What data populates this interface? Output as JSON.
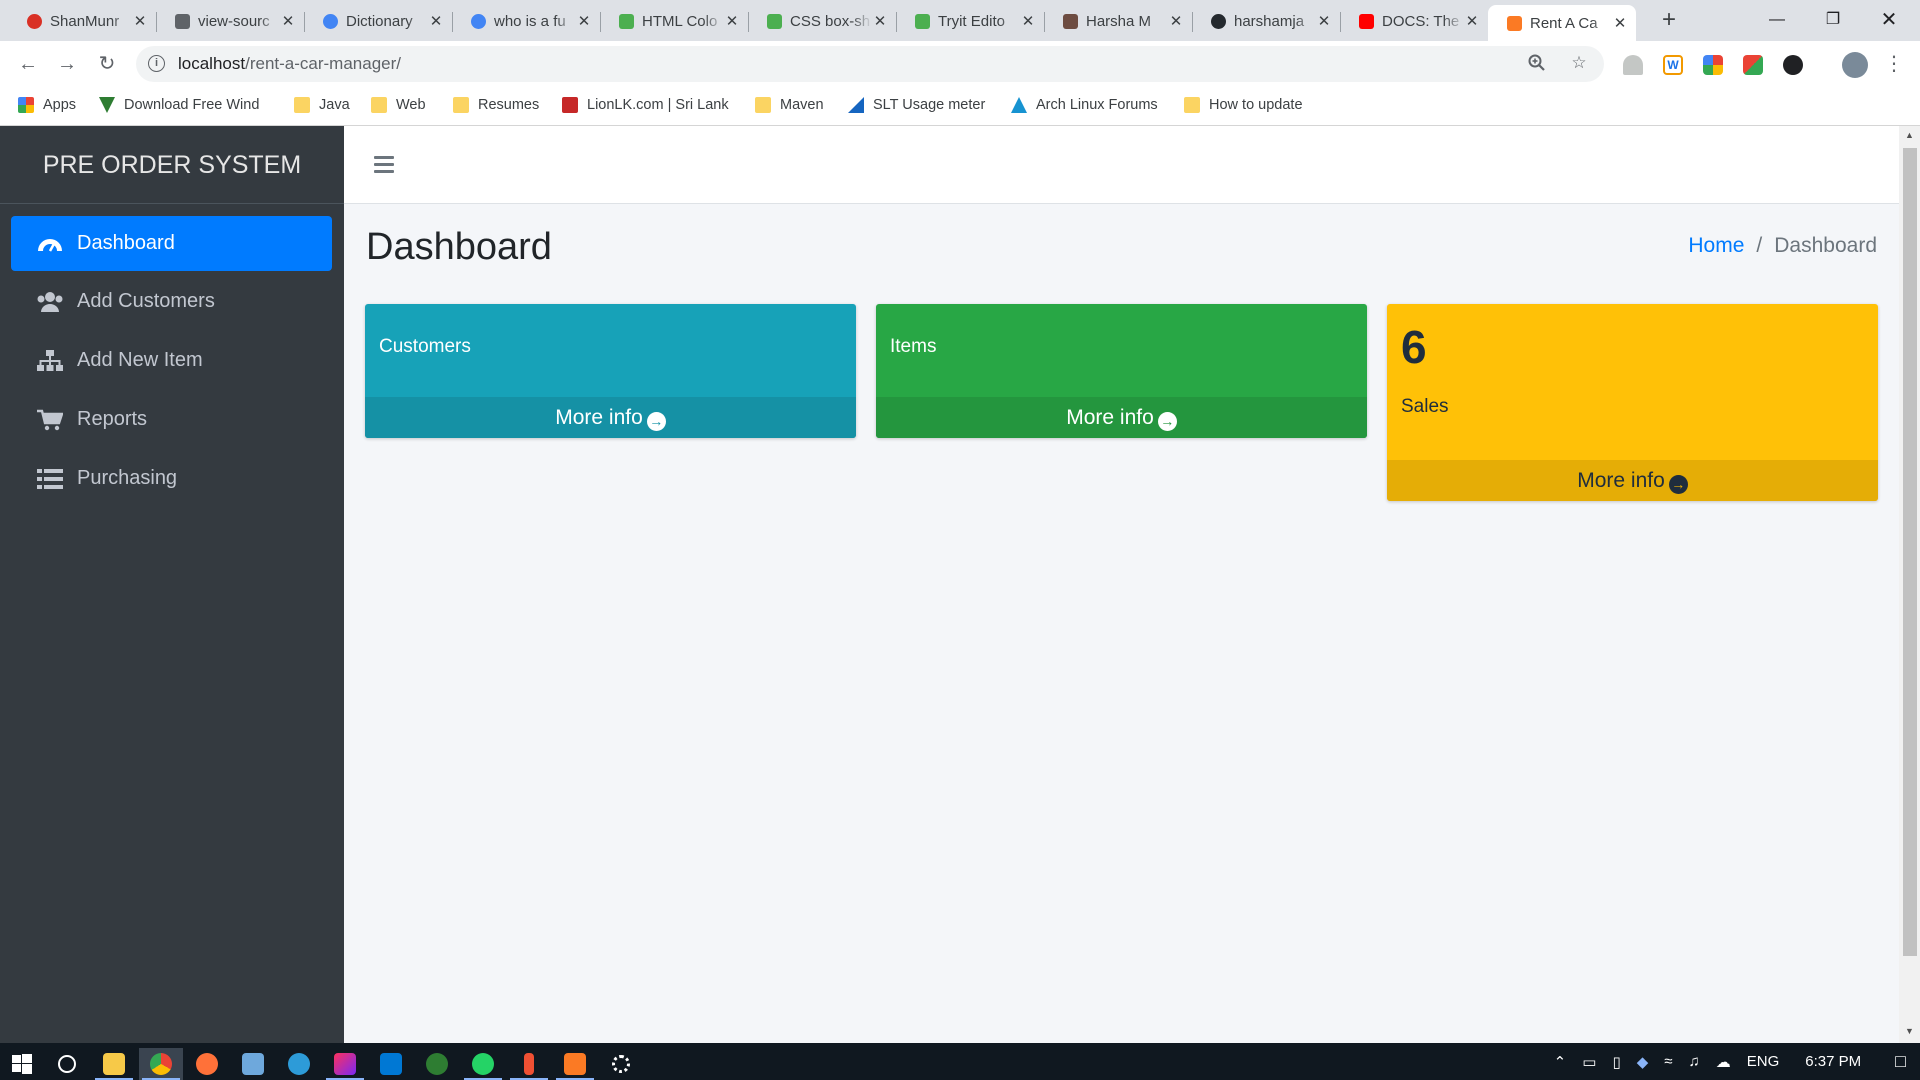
{
  "tabs": [
    {
      "title": "ShanMunr",
      "favicon": "shanmuni-icon",
      "color": "#d93025"
    },
    {
      "title": "view-sourc",
      "favicon": "document-icon",
      "color": "#5f6368"
    },
    {
      "title": "Dictionary",
      "favicon": "google-icon",
      "color": "#4285f4"
    },
    {
      "title": "who is a fu",
      "favicon": "google-icon",
      "color": "#4285f4"
    },
    {
      "title": "HTML Colo",
      "favicon": "w3schools-icon",
      "color": "#4caf50"
    },
    {
      "title": "CSS box-sh",
      "favicon": "w3schools-icon",
      "color": "#4caf50"
    },
    {
      "title": "Tryit Edito",
      "favicon": "w3schools-icon",
      "color": "#4caf50"
    },
    {
      "title": "Harsha M",
      "favicon": "avatar-icon",
      "color": "#6d4c41"
    },
    {
      "title": "harshamja",
      "favicon": "github-icon",
      "color": "#24292e"
    },
    {
      "title": "DOCS: The",
      "favicon": "youtube-icon",
      "color": "#ff0000"
    },
    {
      "title": "Rent A Ca",
      "favicon": "xampp-icon",
      "color": "#fb7a24",
      "active": true
    }
  ],
  "toolbar": {
    "url_host": "localhost",
    "url_path": "/rent-a-car-manager/",
    "info_glyph": "i"
  },
  "bookmarks": [
    {
      "label": "Apps",
      "icon": "apps-grid-icon"
    },
    {
      "label": "Download Free Wind",
      "icon": "download-icon"
    },
    {
      "label": "Java",
      "icon": "folder-icon"
    },
    {
      "label": "Web",
      "icon": "folder-icon"
    },
    {
      "label": "Resumes",
      "icon": "folder-icon"
    },
    {
      "label": "LionLK.com | Sri Lank",
      "icon": "lionlk-icon"
    },
    {
      "label": "Maven",
      "icon": "folder-icon"
    },
    {
      "label": "SLT Usage meter",
      "icon": "slt-icon"
    },
    {
      "label": "Arch Linux Forums",
      "icon": "arch-icon"
    },
    {
      "label": "How to update",
      "icon": "folder-icon"
    }
  ],
  "sidebar": {
    "brand": "PRE ORDER SYSTEM",
    "items": [
      {
        "label": "Dashboard",
        "icon": "tachometer-icon",
        "active": true
      },
      {
        "label": "Add Customers",
        "icon": "users-icon"
      },
      {
        "label": "Add New Item",
        "icon": "sitemap-icon"
      },
      {
        "label": "Reports",
        "icon": "shopping-cart-icon"
      },
      {
        "label": "Purchasing",
        "icon": "list-icon"
      }
    ]
  },
  "header": {
    "page_title": "Dashboard",
    "breadcrumb": {
      "home": "Home",
      "separator": "/",
      "current": "Dashboard"
    }
  },
  "boxes": [
    {
      "label": "Customers",
      "number": "",
      "more": "More info",
      "color": "#17a2b8",
      "footer_color": "#1591a5"
    },
    {
      "label": "Items",
      "number": "",
      "more": "More info",
      "color": "#28a745",
      "footer_color": "#24963e"
    },
    {
      "label": "Sales",
      "number": "6",
      "more": "More info",
      "color": "#ffc107",
      "footer_color": "#e5ad06"
    }
  ],
  "more_icon": "arrow-circle-right-icon",
  "taskbar": {
    "language": "ENG",
    "time": "6:37 PM"
  }
}
